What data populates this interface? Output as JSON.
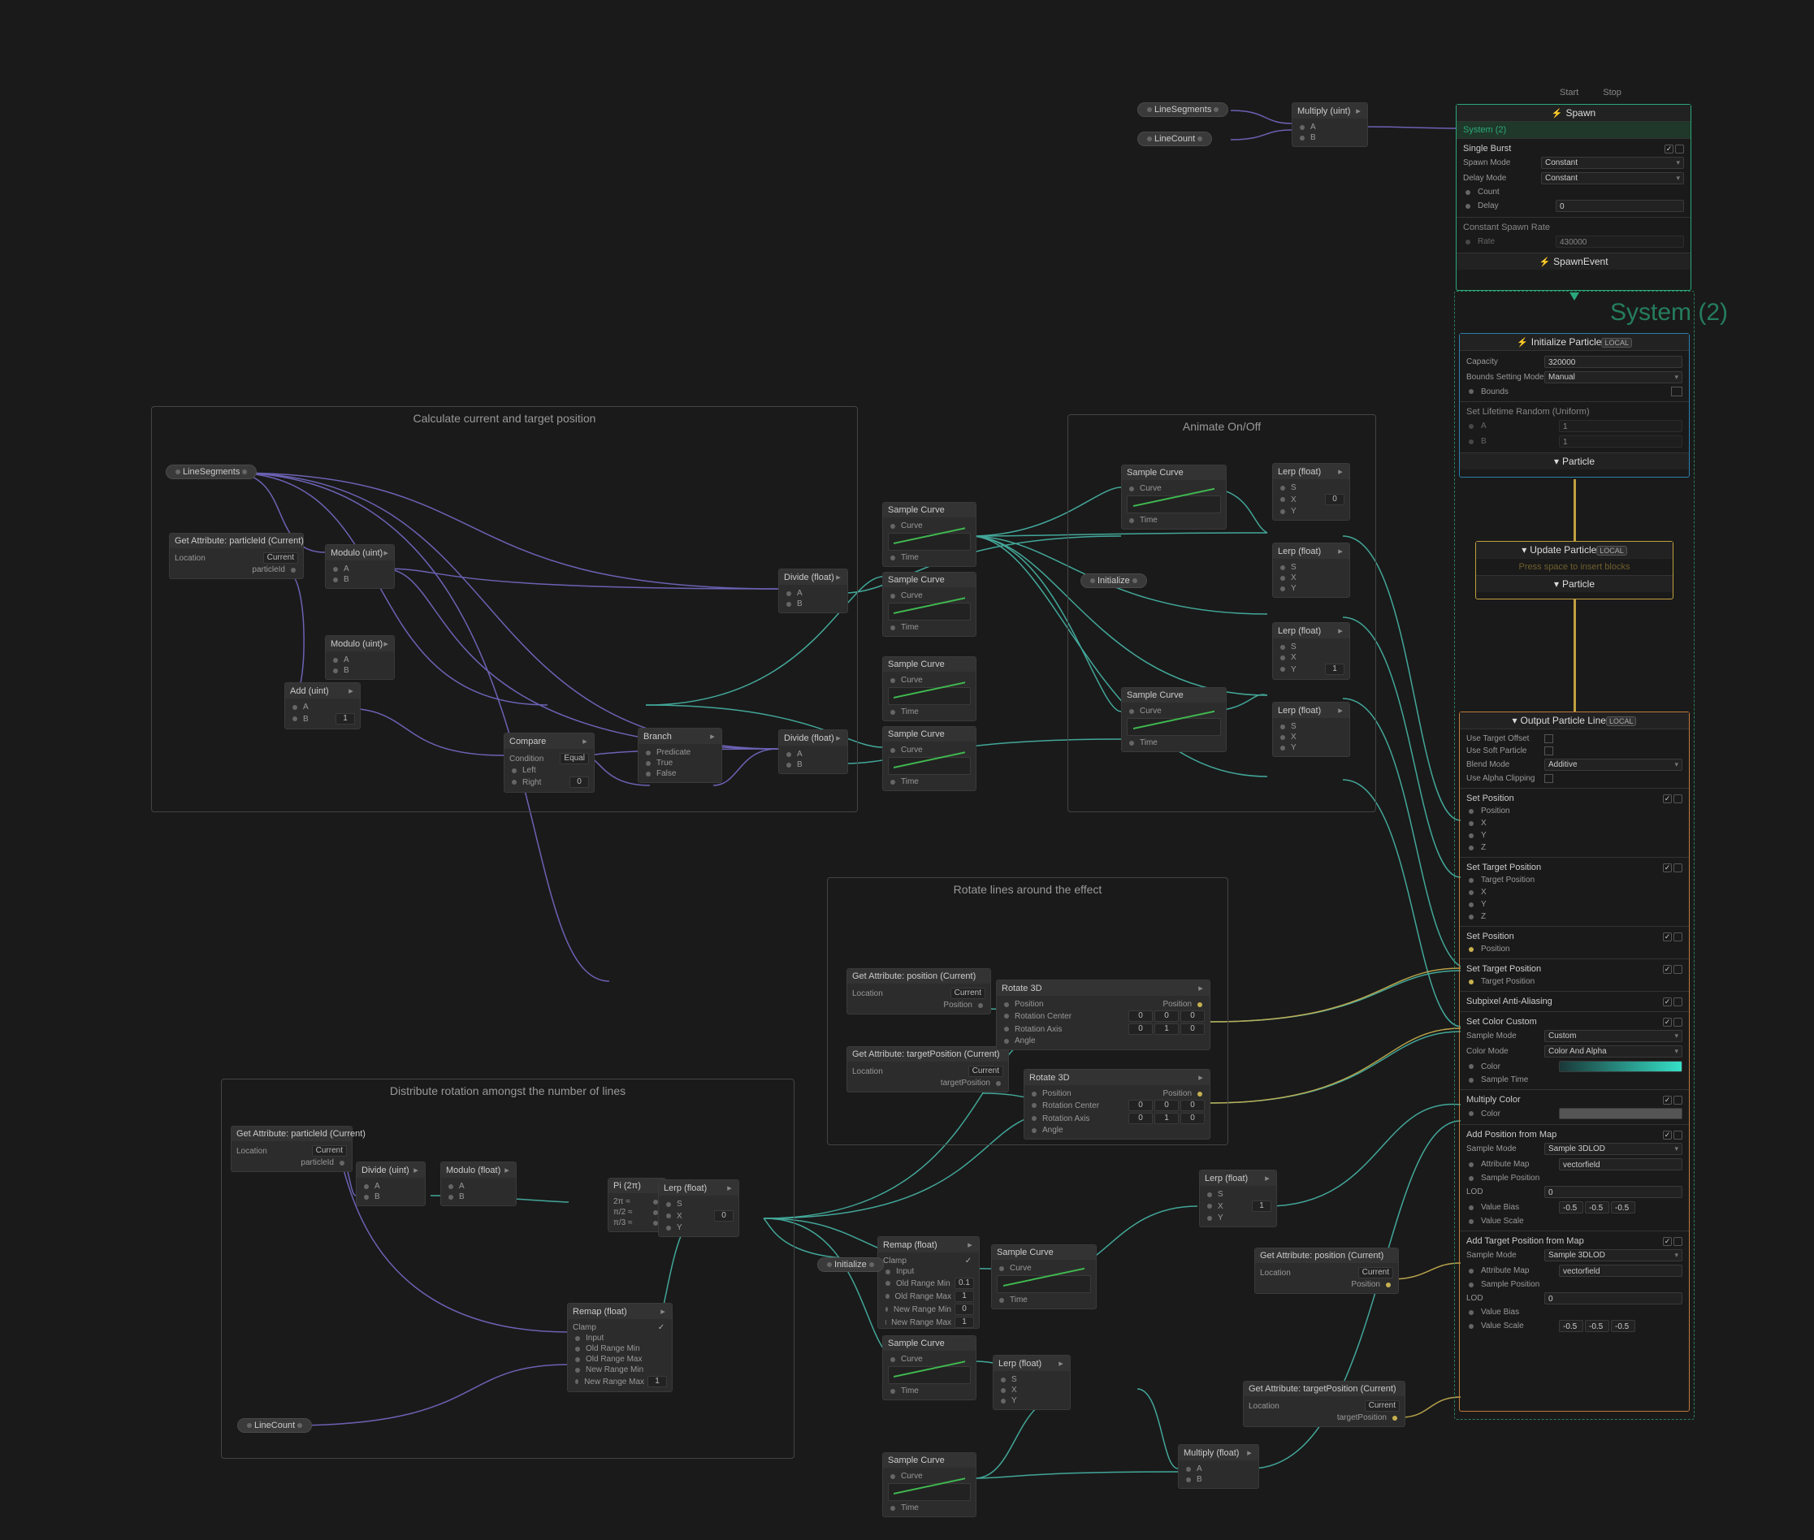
{
  "start_stop": {
    "start": "Start",
    "stop": "Stop"
  },
  "system2": "System (2)",
  "system2_watermark": "System (2)",
  "spawn": {
    "title": "Spawn",
    "single_burst": "Single Burst",
    "spawn_mode": "Spawn Mode",
    "spawn_mode_v": "Constant",
    "delay_mode": "Delay Mode",
    "delay_mode_v": "Constant",
    "count": "Count",
    "delay": "Delay",
    "delay_v": "0",
    "constant_rate": "Constant Spawn Rate",
    "rate": "Rate",
    "rate_v": "430000",
    "footer": "SpawnEvent"
  },
  "init": {
    "title": "Initialize Particle",
    "badge": "LOCAL",
    "capacity": "Capacity",
    "capacity_v": "320000",
    "bounds_mode": "Bounds Setting Mode",
    "bounds_mode_v": "Manual",
    "bounds": "Bounds",
    "set_lifetime": "Set Lifetime Random (Uniform)",
    "a": "A",
    "a_v": "1",
    "b": "B",
    "b_v": "1",
    "footer": "Particle"
  },
  "update": {
    "title": "Update Particle",
    "badge": "LOCAL",
    "hint": "Press space to insert blocks",
    "footer": "Particle"
  },
  "output": {
    "title": "Output Particle Line",
    "badge": "LOCAL",
    "use_target_offset": "Use Target Offset",
    "use_soft_particle": "Use Soft Particle",
    "blend_mode": "Blend Mode",
    "blend_mode_v": "Additive",
    "use_alpha": "Use Alpha Clipping",
    "set_position": "Set Position",
    "position": "Position",
    "x": "X",
    "y": "Y",
    "z": "Z",
    "set_target_pos": "Set Target Position",
    "target_pos": "Target Position",
    "set_position2": "Set Position",
    "set_target_pos2": "Set Target Position",
    "subpixel": "Subpixel Anti-Aliasing",
    "set_color": "Set Color Custom",
    "sample_mode": "Sample Mode",
    "sample_mode_v": "Custom",
    "color_mode": "Color Mode",
    "color_mode_v": "Color And Alpha",
    "color": "Color",
    "sample_time": "Sample Time",
    "multiply_color": "Multiply Color",
    "add_pos_map": "Add Position from Map",
    "sample_mode2_v": "Sample 3DLOD",
    "attr_map": "Attribute Map",
    "attr_map_v": "vectorfield",
    "sample_pos": "Sample Position",
    "lod": "LOD",
    "lod_v": "0",
    "value_bias": "Value Bias",
    "value_bias_v": [
      "-0.5",
      "-0.5",
      "-0.5"
    ],
    "value_scale": "Value Scale",
    "add_tpos_map": "Add Target Position from Map",
    "value_scale_v": [
      "-0.5",
      "-0.5",
      "-0.5"
    ]
  },
  "groups": {
    "calc": "Calculate current and target position",
    "anim": "Animate On/Off",
    "rotate": "Rotate lines around the effect",
    "dist": "Distribute rotation amongst the number of lines"
  },
  "labels": {
    "linesegments": "LineSegments",
    "linecount": "LineCount",
    "multiply_uint": "Multiply (uint)",
    "get_attr_pid": "Get Attribute: particleId (Current)",
    "location": "Location",
    "current": "Current",
    "particleid": "particleId",
    "modulo_uint": "Modulo (uint)",
    "modulo_float": "Modulo (float)",
    "add_uint": "Add (uint)",
    "compare": "Compare",
    "condition": "Condition",
    "equal": "Equal",
    "left": "Left",
    "right": "Right",
    "branch": "Branch",
    "predicate": "Predicate",
    "true": "True",
    "false": "False",
    "divide_uint": "Divide (uint)",
    "divide_float": "Divide (float)",
    "sample_curve": "Sample Curve",
    "curve": "Curve",
    "time": "Time",
    "lerp_float": "Lerp (float)",
    "s": "S",
    "x": "X",
    "y": "Y",
    "initialize_pill": "Initialize",
    "rotate3d": "Rotate 3D",
    "position": "Position",
    "rot_center": "Rotation Center",
    "rot_axis": "Rotation Axis",
    "angle": "Angle",
    "get_attr_pos": "Get Attribute: position (Current)",
    "get_attr_tpos": "Get Attribute: targetPosition (Current)",
    "target_position": "targetPosition",
    "remap_float": "Remap (float)",
    "clamp": "Clamp",
    "input": "Input",
    "old_min": "Old Range Min",
    "old_max": "Old Range Max",
    "new_min": "New Range Min",
    "new_max": "New Range Max",
    "pi_2n": "Pi (2π)",
    "two_pi": "2π ≈",
    "pi_half": "π/2 ≈",
    "pi_third": "π/3 ≈",
    "multiply_float": "Multiply (float)"
  },
  "vals": {
    "zero": "0",
    "one": "1",
    "v01": "0.1"
  }
}
